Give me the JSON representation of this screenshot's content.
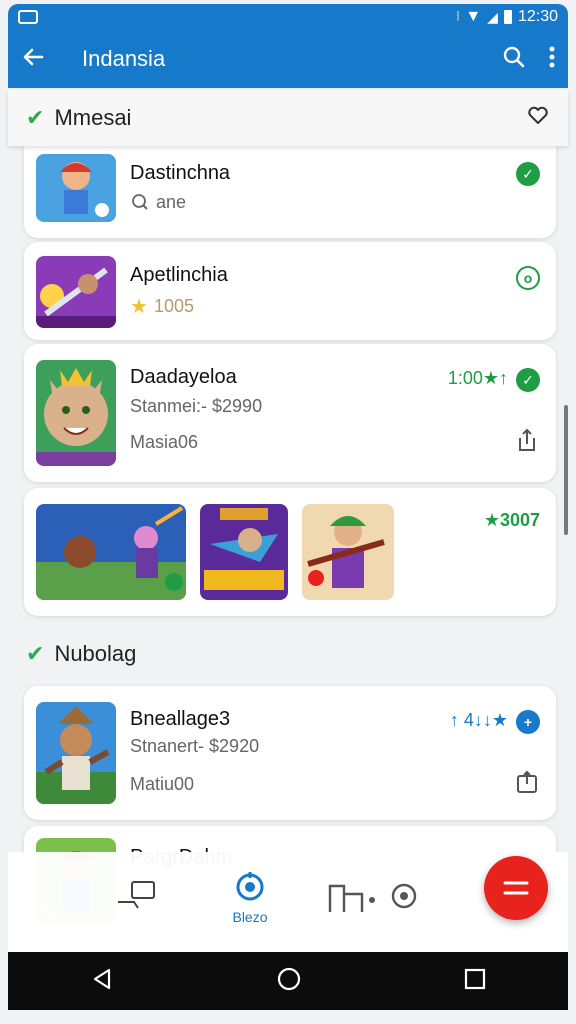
{
  "status_bar": {
    "time": "12:30"
  },
  "app_bar": {
    "title": "Indansia"
  },
  "sections": [
    {
      "title": "Mmesai"
    },
    {
      "title": "Nubolag"
    }
  ],
  "apps": [
    {
      "name": "Dastinchna",
      "sub1": "ane"
    },
    {
      "name": "Apetlinchia",
      "sub1": "1005"
    },
    {
      "name": "Daadayeloa",
      "sub1": "Stanmei:- $2990",
      "sub2": "Masia06",
      "rating": "1:00★↑"
    },
    {
      "name": "Bneallage3",
      "sub1": "Stnanert- $2920",
      "sub2": "Matiu00",
      "rating": "↑ 4↓↓★"
    },
    {
      "name": "PargrDahm"
    }
  ],
  "gallery": {
    "rating": "★3007"
  },
  "bottom_nav": {
    "active_label": "Blezo"
  },
  "colors": {
    "primary": "#1679c9",
    "accent_green": "#1f9d45",
    "fab": "#e8231e"
  }
}
